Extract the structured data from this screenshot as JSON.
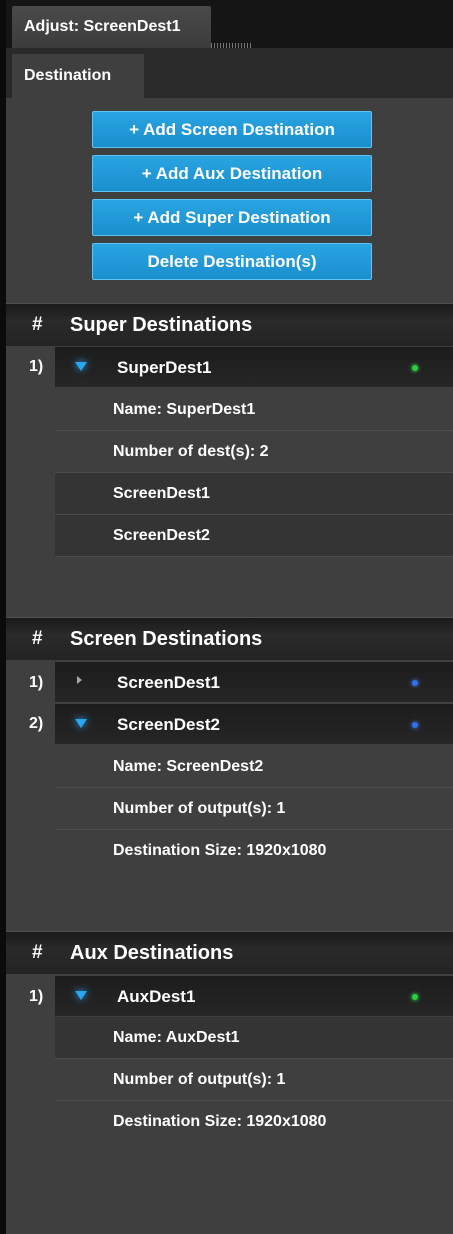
{
  "title_tab": "Adjust: ScreenDest1",
  "tabs": [
    {
      "label": "Destination"
    }
  ],
  "buttons": {
    "add_screen": "+ Add Screen Destination",
    "add_aux": "+ Add Aux Destination",
    "add_super": "+ Add Super Destination",
    "delete": "Delete Destination(s)"
  },
  "sections": {
    "super": {
      "hash": "#",
      "title": "Super Destinations",
      "items": [
        {
          "num": "1)",
          "name": "SuperDest1",
          "expanded": true,
          "status_color": "#2ecc40",
          "details": [
            "Name: SuperDest1",
            "Number of dest(s): 2",
            "ScreenDest1",
            "ScreenDest2"
          ]
        }
      ]
    },
    "screen": {
      "hash": "#",
      "title": "Screen Destinations",
      "items": [
        {
          "num": "1)",
          "name": "ScreenDest1",
          "expanded": false,
          "status_color": "#2f6ff0"
        },
        {
          "num": "2)",
          "name": "ScreenDest2",
          "expanded": true,
          "status_color": "#2f6ff0",
          "details": [
            "Name: ScreenDest2",
            "Number of output(s): 1",
            "Destination Size: 1920x1080"
          ]
        }
      ]
    },
    "aux": {
      "hash": "#",
      "title": "Aux Destinations",
      "items": [
        {
          "num": "1)",
          "name": "AuxDest1",
          "expanded": true,
          "status_color": "#2ecc40",
          "details": [
            "Name: AuxDest1",
            "Number of output(s): 1",
            "Destination Size: 1920x1080"
          ]
        }
      ]
    }
  },
  "colors": {
    "accent": "#1a8fce",
    "status_green": "#2ecc40",
    "status_blue": "#2f6ff0"
  }
}
